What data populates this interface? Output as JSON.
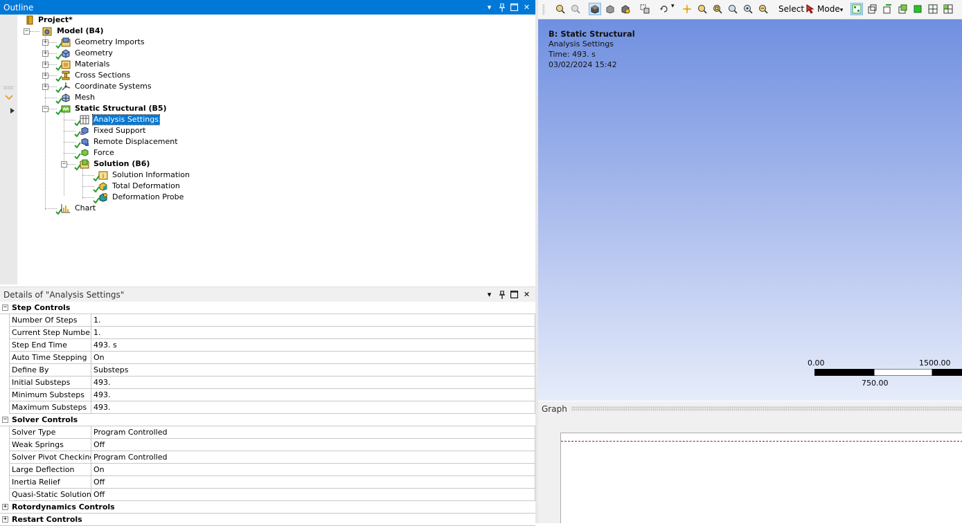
{
  "outline": {
    "title": "Outline",
    "tree": {
      "project": "Project*",
      "model": "Model (B4)",
      "geometry_imports": "Geometry Imports",
      "geometry": "Geometry",
      "materials": "Materials",
      "cross_sections": "Cross Sections",
      "coordinate_systems": "Coordinate Systems",
      "mesh": "Mesh",
      "static_structural": "Static Structural (B5)",
      "analysis_settings": "Analysis Settings",
      "fixed_support": "Fixed Support",
      "remote_displacement": "Remote Displacement",
      "force": "Force",
      "solution": "Solution (B6)",
      "solution_information": "Solution Information",
      "total_deformation": "Total Deformation",
      "deformation_probe": "Deformation Probe",
      "chart": "Chart"
    }
  },
  "details": {
    "title": "Details of \"Analysis Settings\"",
    "groups": [
      {
        "label": "Step Controls",
        "expanded": true,
        "rows": [
          {
            "name": "Number Of Steps",
            "value": "1."
          },
          {
            "name": "Current Step Number",
            "value": "1."
          },
          {
            "name": "Step End Time",
            "value": "493. s"
          },
          {
            "name": "Auto Time Stepping",
            "value": "On"
          },
          {
            "name": "Define By",
            "value": "Substeps"
          },
          {
            "name": "Initial Substeps",
            "value": "493."
          },
          {
            "name": "Minimum Substeps",
            "value": "493."
          },
          {
            "name": "Maximum Substeps",
            "value": "493."
          }
        ]
      },
      {
        "label": "Solver Controls",
        "expanded": true,
        "rows": [
          {
            "name": "Solver Type",
            "value": "Program Controlled"
          },
          {
            "name": "Weak Springs",
            "value": "Off"
          },
          {
            "name": "Solver Pivot Checking",
            "value": "Program Controlled"
          },
          {
            "name": "Large Deflection",
            "value": "On"
          },
          {
            "name": "Inertia Relief",
            "value": "Off"
          },
          {
            "name": "Quasi-Static Solution",
            "value": "Off"
          }
        ]
      },
      {
        "label": "Rotordynamics Controls",
        "expanded": false,
        "rows": []
      },
      {
        "label": "Restart Controls",
        "expanded": false,
        "rows": []
      }
    ]
  },
  "toolbar": {
    "select_label": "Select",
    "mode_label": "Mode"
  },
  "viewport": {
    "title": "B: Static Structural",
    "subtitle": "Analysis Settings",
    "time": "Time: 493. s",
    "date": "03/02/2024 15:42",
    "scale_left": "0.00",
    "scale_right": "1500.00",
    "scale_mid": "750.00"
  },
  "graph": {
    "title": "Graph"
  },
  "colors": {
    "header_blue": "#0078d7",
    "check_green": "#2a9d2a",
    "viewport_top": "#6f8fe0",
    "viewport_bottom": "#e6ecfa"
  }
}
